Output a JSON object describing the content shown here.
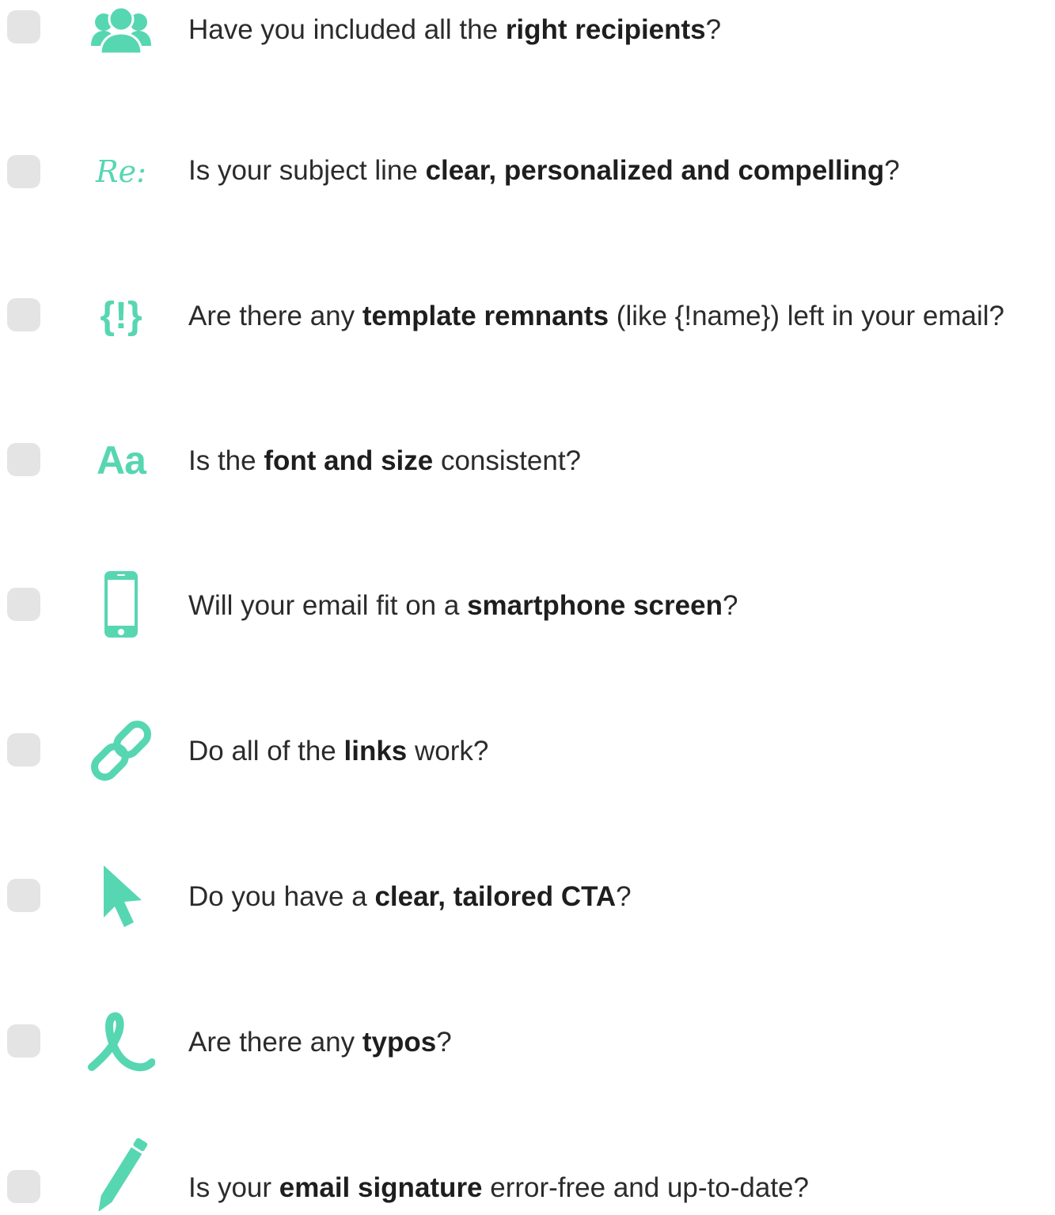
{
  "accent_color": "#57d6b2",
  "checklist": [
    {
      "icon": "users-icon",
      "before": "Have you included all the ",
      "bold": "right recipients",
      "after": "?"
    },
    {
      "icon": "re-icon",
      "icon_text": "Re:",
      "before": "Is your subject line ",
      "bold": "clear, personalized and compelling",
      "after": "?"
    },
    {
      "icon": "template-braces-icon",
      "icon_text": "{!}",
      "before": "Are there any ",
      "bold": "template remnants",
      "after": " (like {!name}) left in your email?"
    },
    {
      "icon": "font-icon",
      "icon_text": "Aa",
      "before": "Is the ",
      "bold": "font and size",
      "after": " consistent?"
    },
    {
      "icon": "smartphone-icon",
      "before": "Will your email fit on a ",
      "bold": "smartphone screen",
      "after": "?"
    },
    {
      "icon": "link-icon",
      "before": "Do all of the ",
      "bold": "links",
      "after": " work?"
    },
    {
      "icon": "cursor-icon",
      "before": "Do you have a ",
      "bold": "clear, tailored CTA",
      "after": "?"
    },
    {
      "icon": "signature-loop-icon",
      "before": "Are there any ",
      "bold": "typos",
      "after": "?"
    },
    {
      "icon": "pen-icon",
      "before": "Is your ",
      "bold": "email signature",
      "after": " error-free and up-to-date?"
    }
  ]
}
